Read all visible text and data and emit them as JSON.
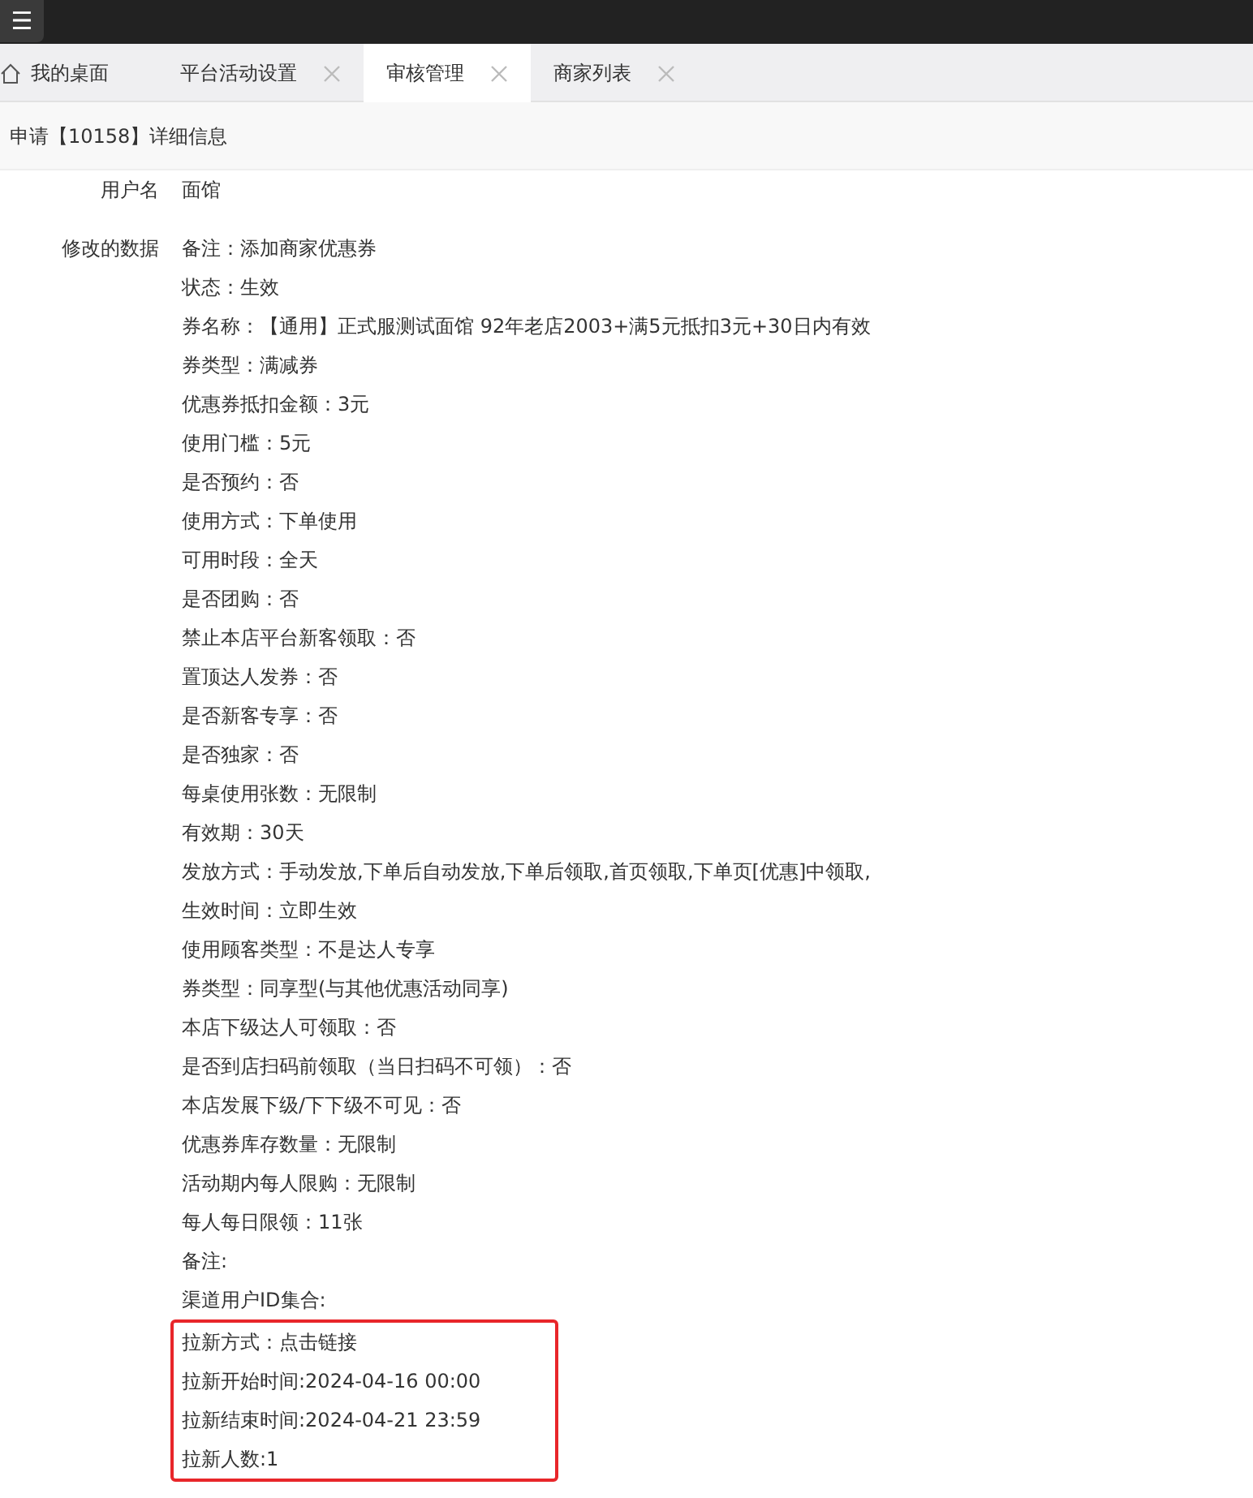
{
  "menu_button": {
    "icon": "☰"
  },
  "tabs": [
    {
      "label": "我的桌面",
      "kind": "home",
      "selected": false,
      "closable": false
    },
    {
      "label": "平台活动设置",
      "kind": "page",
      "selected": false,
      "closable": true
    },
    {
      "label": "审核管理",
      "kind": "page",
      "selected": true,
      "closable": true
    },
    {
      "label": "商家列表",
      "kind": "page",
      "selected": false,
      "closable": true
    }
  ],
  "page_title": "申请【10158】详细信息",
  "fields": [
    {
      "label": "用户名",
      "lines": [
        "面馆"
      ]
    },
    {
      "label": "修改的数据",
      "lines": [
        "备注：添加商家优惠券",
        "状态：生效",
        "券名称：【通用】正式服测试面馆 92年老店2003+满5元抵扣3元+30日内有效",
        "券类型：满减券",
        "优惠券抵扣金额：3元",
        "使用门槛：5元",
        "是否预约：否",
        "使用方式：下单使用",
        "可用时段：全天",
        "是否团购：否",
        "禁止本店平台新客领取：否",
        "置顶达人发券：否",
        "是否新客专享：否",
        "是否独家：否",
        "每桌使用张数：无限制",
        "有效期：30天",
        "发放方式：手动发放,下单后自动发放,下单后领取,首页领取,下单页[优惠]中领取,",
        "生效时间：立即生效",
        "使用顾客类型：不是达人专享",
        "券类型：同享型(与其他优惠活动同享)",
        "本店下级达人可领取：否",
        "是否到店扫码前领取（当日扫码不可领）：否",
        "本店发展下级/下下级不可见：否",
        "优惠券库存数量：无限制",
        "活动期内每人限购：无限制",
        "每人每日限领：11张",
        "备注:",
        "渠道用户ID集合:"
      ],
      "highlighted_lines": [
        "拉新方式：点击链接",
        "拉新开始时间:2024-04-16 00:00",
        "拉新结束时间:2024-04-21 23:59",
        "拉新人数:1"
      ]
    }
  ]
}
